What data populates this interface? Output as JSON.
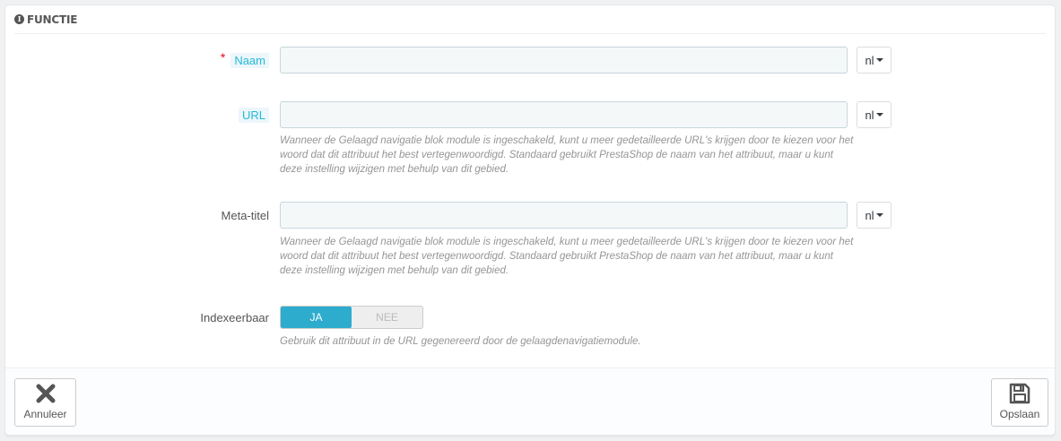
{
  "panel": {
    "title": "FUNCTIE",
    "icon": "info-circle-icon"
  },
  "fields": {
    "naam": {
      "label": "Naam",
      "required_mark": "*",
      "value": "",
      "lang": "nl"
    },
    "url": {
      "label": "URL",
      "value": "",
      "lang": "nl",
      "help": "Wanneer de Gelaagd navigatie blok module is ingeschakeld, kunt u meer gedetailleerde URL's krijgen door te kiezen voor het woord dat dit attribuut het best vertegenwoordigd. Standaard gebruikt PrestaShop de naam van het attribuut, maar u kunt deze instelling wijzigen met behulp van dit gebied."
    },
    "meta_title": {
      "label": "Meta-titel",
      "value": "",
      "lang": "nl",
      "help": "Wanneer de Gelaagd navigatie blok module is ingeschakeld, kunt u meer gedetailleerde URL's krijgen door te kiezen voor het woord dat dit attribuut het best vertegenwoordigd. Standaard gebruikt PrestaShop de naam van het attribuut, maar u kunt deze instelling wijzigen met behulp van dit gebied."
    },
    "indexable": {
      "label": "Indexeerbaar",
      "yes": "JA",
      "no": "NEE",
      "selected": "JA",
      "help": "Gebruik dit attribuut in de URL gegenereerd door de gelaagdenavigatiemodule."
    }
  },
  "footer": {
    "cancel_label": "Annuleer",
    "cancel_icon": "close-icon",
    "save_label": "Opslaan",
    "save_icon": "floppy-disk-icon"
  },
  "colors": {
    "accent": "#2eacce",
    "required": "#e3001b",
    "hint_label": "#25b9d7"
  }
}
